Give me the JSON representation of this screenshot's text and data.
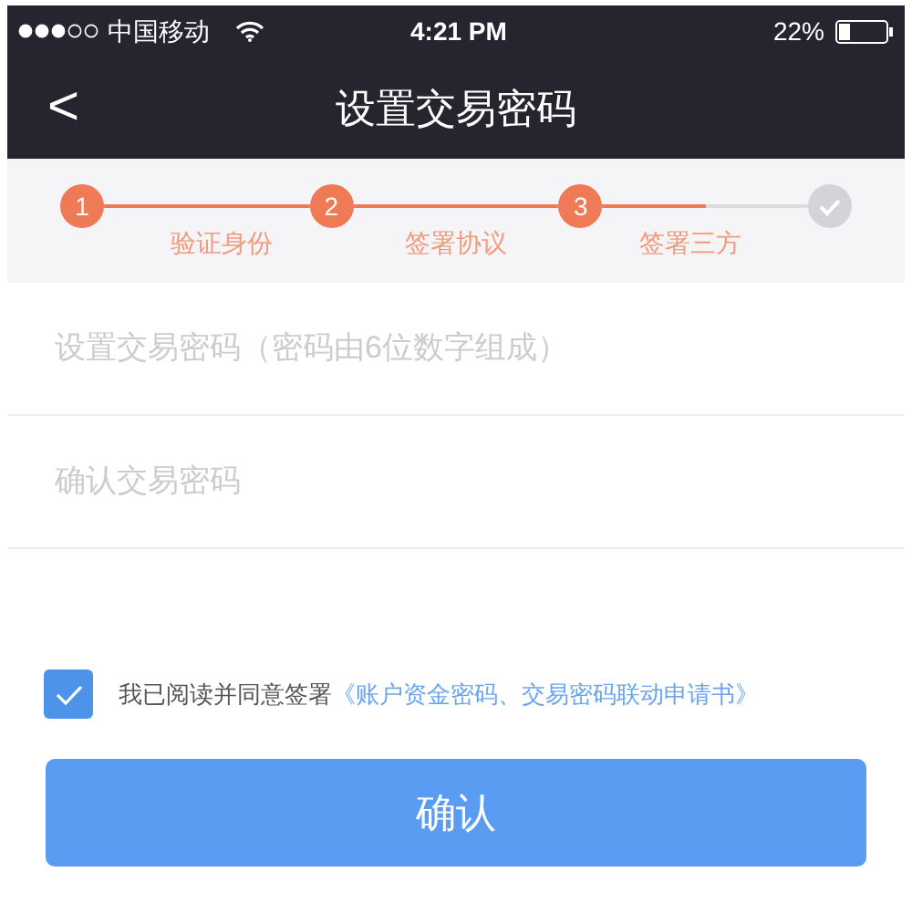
{
  "status_bar": {
    "carrier": "中国移动",
    "time": "4:21 PM",
    "battery": "22%"
  },
  "nav": {
    "back": "<",
    "title": "设置交易密码"
  },
  "steps": [
    {
      "number": "1",
      "label": "验证身份",
      "done": true
    },
    {
      "number": "2",
      "label": "签署协议",
      "done": true
    },
    {
      "number": "3",
      "label": "签署三方",
      "done": true
    },
    {
      "done": false
    }
  ],
  "fields": [
    {
      "placeholder": "设置交易密码（密码由6位数字组成）"
    },
    {
      "placeholder": "确认交易密码"
    }
  ],
  "agreement": {
    "checked": true,
    "text": "我已阅读并同意签署",
    "link": "《账户资金密码、交易密码联动申请书》"
  },
  "confirm_button": "确认"
}
